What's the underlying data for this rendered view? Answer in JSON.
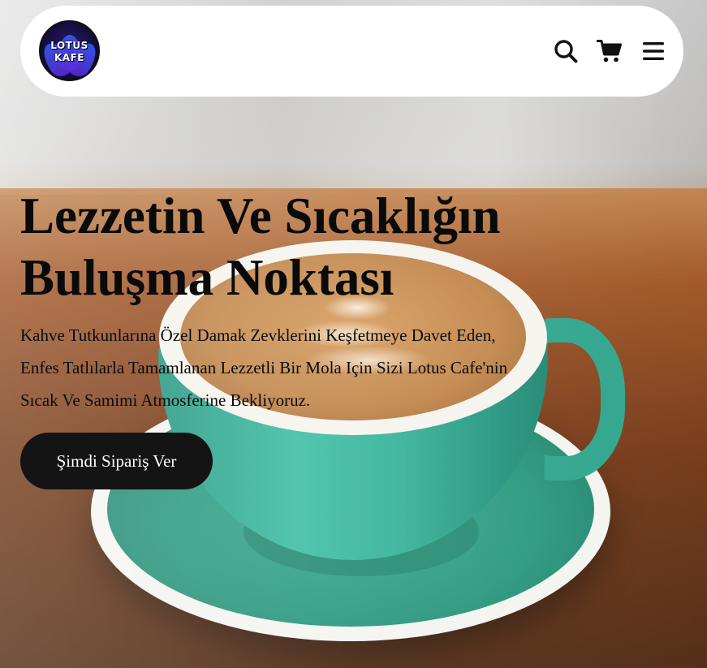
{
  "brand": {
    "logo_line1": "LOTUS",
    "logo_line2": "KAFE"
  },
  "nav": {
    "icons": [
      "search-icon",
      "cart-icon",
      "menu-icon"
    ]
  },
  "hero": {
    "title_line1": "Lezzetin Ve Sıcaklığın",
    "title_line2": "Buluşma Noktası",
    "text_line1": "Kahve Tutkunlarına Özel Damak Zevklerini Keşfetmeye Davet Eden,",
    "text_line2": "Enfes Tatlılarla Tamamlanan Lezzetli Bir Mola Için Sizi Lotus Cafe'nin",
    "text_line3": "Sıcak Ve Samimi Atmosferine Bekliyoruz.",
    "cta_label": "Şimdi Sipariş Ver"
  },
  "colors": {
    "header_bg": "#ffffff",
    "button_bg": "#141414",
    "button_text": "#ffffff",
    "text": "#0a0a0a",
    "cup": "#3cb59c"
  }
}
